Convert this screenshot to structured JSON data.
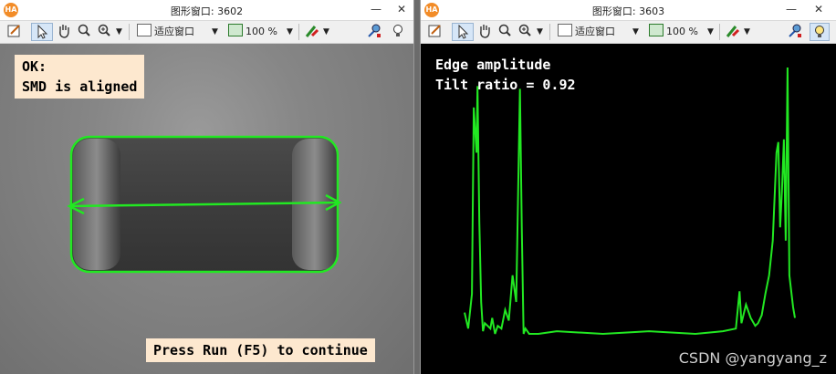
{
  "windows": {
    "left": {
      "logo": "HA",
      "title": "图形窗口: 3602",
      "fit_label": "适应窗口",
      "zoom": "100 %",
      "message_ok": "OK:",
      "message_detail": "SMD is aligned",
      "prompt": "Press Run (F5) to continue"
    },
    "right": {
      "logo": "HA",
      "title": "图形窗口: 3603",
      "fit_label": "适应窗口",
      "zoom": "100 %",
      "plot_title": "Edge amplitude",
      "tilt_text": "Tilt ratio = 0.92"
    }
  },
  "controls": {
    "minimize": "—",
    "close": "✕"
  },
  "icons": [
    "settings-icon",
    "pointer-icon",
    "hand-icon",
    "zoom-icon",
    "zoom-plus-icon",
    "fit-window-icon",
    "zoom-level-icon",
    "color-tool-icon",
    "inspect-icon",
    "bulb-icon"
  ],
  "colors": {
    "overlay_green": "#22e822",
    "message_bg": "#fde8cf"
  },
  "watermark": "CSDN @yangyang_z",
  "chart_data": {
    "type": "line",
    "title": "Edge amplitude",
    "annotation": "Tilt ratio = 0.92",
    "series": [
      {
        "color": "#22e822",
        "x": [
          0,
          4,
          8,
          10,
          13,
          14,
          16,
          18,
          20,
          22,
          25,
          28,
          30,
          33,
          36,
          40,
          44,
          48,
          52,
          56,
          60,
          62,
          64,
          66,
          68,
          70,
          80,
          100,
          150,
          200,
          250,
          280,
          294,
          298,
          300,
          305,
          310,
          315,
          318,
          322,
          326,
          330,
          334,
          338,
          340,
          342,
          344,
          346,
          348,
          350,
          352,
          356,
          358
        ],
        "y": [
          0.08,
          0.02,
          0.15,
          0.85,
          0.68,
          0.93,
          0.42,
          0.12,
          0.01,
          0.04,
          0.03,
          0.02,
          0.06,
          0.0,
          0.03,
          0.02,
          0.09,
          0.05,
          0.22,
          0.12,
          0.92,
          0.4,
          0.0,
          0.02,
          0.01,
          0.0,
          0.0,
          0.01,
          0.0,
          0.01,
          0.0,
          0.01,
          0.02,
          0.16,
          0.04,
          0.11,
          0.06,
          0.03,
          0.04,
          0.07,
          0.15,
          0.22,
          0.35,
          0.68,
          0.72,
          0.4,
          0.54,
          0.73,
          0.35,
          1.0,
          0.22,
          0.1,
          0.06
        ]
      }
    ]
  }
}
